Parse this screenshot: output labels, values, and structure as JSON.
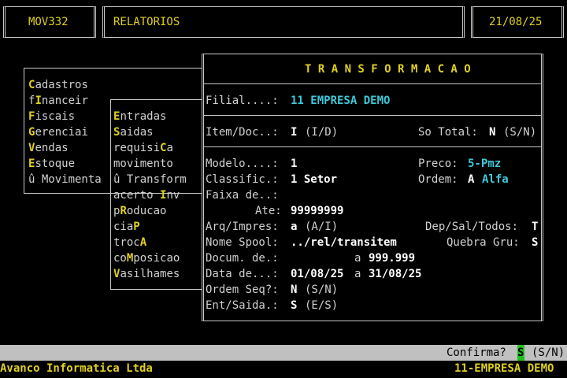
{
  "header": {
    "program": "MOV332",
    "title": "RELATORIOS",
    "date": "21/08/25"
  },
  "main_menu": [
    {
      "pre": "",
      "key": "C",
      "post": "adastros"
    },
    {
      "pre": "f",
      "key": "I",
      "post": "nanceir"
    },
    {
      "pre": "",
      "key": "F",
      "post": "iscais"
    },
    {
      "pre": "",
      "key": "G",
      "post": "erenciai"
    },
    {
      "pre": "",
      "key": "V",
      "post": "endas"
    },
    {
      "pre": "",
      "key": "E",
      "post": "stoque"
    },
    {
      "pre": "û Movimenta",
      "key": "",
      "post": ""
    }
  ],
  "sub_menu": [
    {
      "pre": "",
      "key": "E",
      "post": "ntradas"
    },
    {
      "pre": "",
      "key": "S",
      "post": "aidas"
    },
    {
      "pre": "requisi",
      "key": "C",
      "post": "a"
    },
    {
      "pre": "movimento",
      "key": "",
      "post": ""
    },
    {
      "pre": "û Transform",
      "key": "",
      "post": ""
    },
    {
      "pre": "acerto ",
      "key": "I",
      "post": "nv"
    },
    {
      "pre": "p",
      "key": "R",
      "post": "oducao"
    },
    {
      "pre": "cia",
      "key": "P",
      "post": ""
    },
    {
      "pre": "troc",
      "key": "A",
      "post": ""
    },
    {
      "pre": "co",
      "key": "M",
      "post": "posicao"
    },
    {
      "pre": "",
      "key": "V",
      "post": "asilhames"
    }
  ],
  "dialog": {
    "title": "T R A N S F O R M A C A O",
    "filial_label": "Filial....:",
    "filial_value": "11 EMPRESA DEMO",
    "item_label": "Item/Doc..:",
    "item_value": "I",
    "item_hint": "(I/D)",
    "sototal_label": "So Total:",
    "sototal_value": "N",
    "sototal_hint": "(S/N)",
    "modelo_label": "Modelo....:",
    "modelo_value": "1",
    "preco_label": "Preco:",
    "preco_value": "5-Pmz",
    "classif_label": "Classific.:",
    "classif_value": "1 Setor",
    "ordem_label": "Ordem:",
    "ordem_value": "A",
    "ordem_desc": "Alfa",
    "faixa_label": "Faixa de..:",
    "ate_label": "Ate:",
    "ate_value": "99999999",
    "arq_label": "Arq/Impres:",
    "arq_value": "a",
    "arq_hint": "(A/I)",
    "depsal_label": "Dep/Sal/Todos:",
    "depsal_value": "T",
    "spool_label": "Nome Spool:",
    "spool_value": "../rel/transitem",
    "quebra_label": "Quebra Gru:",
    "quebra_value": "S",
    "docum_label": "Docum. de.:",
    "docum_a": "a",
    "docum_to": "999.999",
    "data_label": "Data de...:",
    "data_from": "01/08/25",
    "data_a": "a",
    "data_to": "31/08/25",
    "ordemseq_label": "Ordem Seq?:",
    "ordemseq_value": "N",
    "ordemseq_hint": "(S/N)",
    "entsaida_label": "Ent/Saida.:",
    "entsaida_value": "S",
    "entsaida_hint": "(E/S)"
  },
  "confirm": {
    "label": "Confirma?",
    "value": "S",
    "hint": "(S/N)"
  },
  "footer": {
    "company": "Avanco Informatica Ltda",
    "branch": "11-EMPRESA DEMO"
  },
  "colors": {
    "background": "#000000",
    "highlight_yellow": "#e0d020",
    "value_cyan": "#3ec8d8",
    "confirm_bar": "#c0c0c0",
    "confirm_cursor": "#20c020"
  }
}
